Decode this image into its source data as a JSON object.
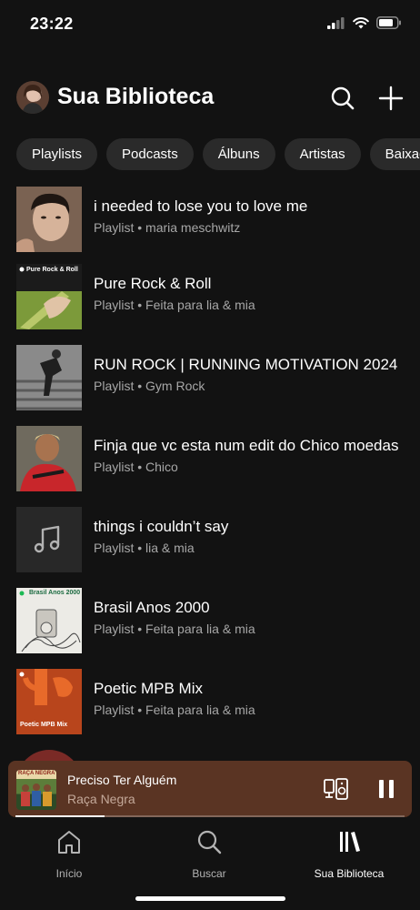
{
  "status_bar": {
    "time": "23:22",
    "icons": [
      "signal-icon",
      "wifi-icon",
      "battery-icon"
    ]
  },
  "header": {
    "title": "Sua Biblioteca",
    "search_icon": "search-icon",
    "add_icon": "plus-icon"
  },
  "filters": [
    "Playlists",
    "Podcasts",
    "Álbuns",
    "Artistas",
    "Baixados"
  ],
  "library": [
    {
      "title": "i needed to lose you to love me",
      "subtitle": "Playlist • maria meschwitz",
      "cover_label": ""
    },
    {
      "title": "Pure Rock & Roll",
      "subtitle": "Playlist • Feita para lia & mia",
      "cover_label": "Pure Rock & Roll"
    },
    {
      "title": "RUN ROCK | RUNNING MOTIVATION 2024",
      "subtitle": "Playlist • Gym Rock",
      "cover_label": ""
    },
    {
      "title": "Finja que vc esta num edit do Chico moedas",
      "subtitle": "Playlist • Chico",
      "cover_label": ""
    },
    {
      "title": "things i couldn’t say",
      "subtitle": "Playlist • lia & mia",
      "cover_label": ""
    },
    {
      "title": "Brasil Anos 2000",
      "subtitle": "Playlist • Feita para lia & mia",
      "cover_label": "Brasil Anos 2000"
    },
    {
      "title": "Poetic MPB Mix",
      "subtitle": "Playlist • Feita para lia & mia",
      "cover_label": "Poetic MPB Mix"
    }
  ],
  "now_playing": {
    "title": "Preciso Ter Alguém",
    "artist": "Raça Negra",
    "cover_label": "RAÇA NEGRA",
    "progress": 0.23
  },
  "nav": {
    "home": "Início",
    "search": "Buscar",
    "library": "Sua Biblioteca"
  },
  "colors": {
    "background": "#121212",
    "chip": "#2a2a2a",
    "player": "#5a3423",
    "muted_text": "#a7a7a7"
  }
}
